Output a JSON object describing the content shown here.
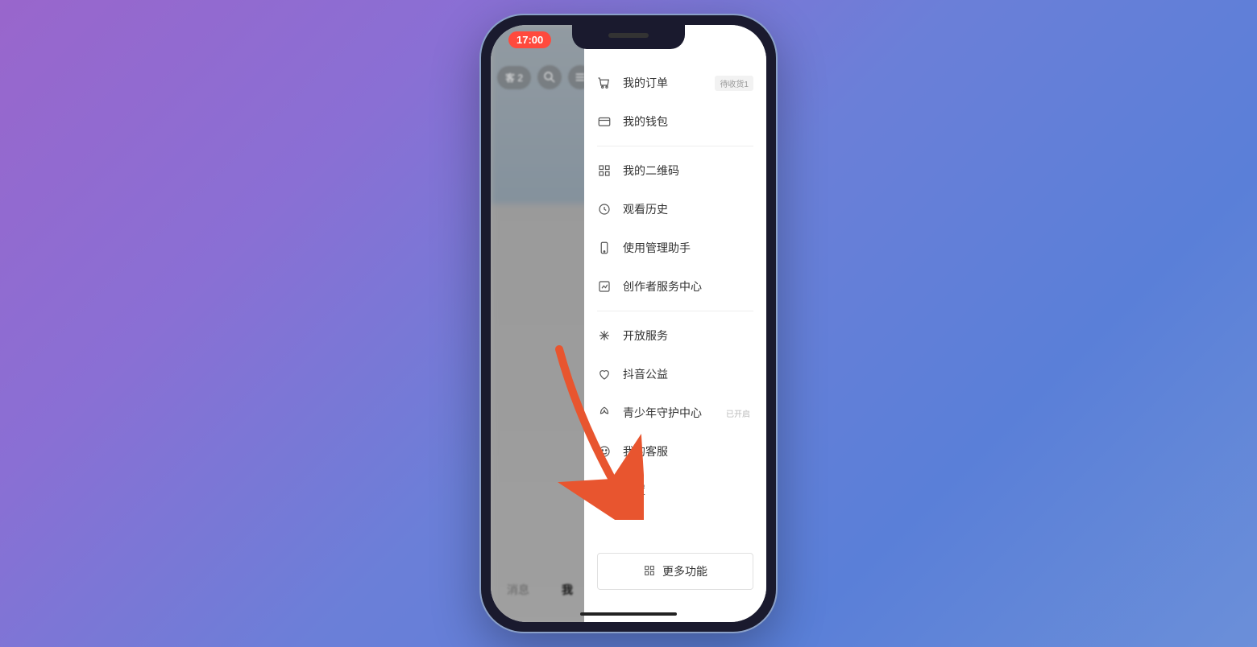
{
  "status": {
    "time": "17:00"
  },
  "background": {
    "top_badge": "客 2",
    "tabs": {
      "messages": "消息",
      "me": "我"
    }
  },
  "drawer": {
    "items": [
      {
        "icon": "cart-icon",
        "label": "我的订单",
        "badge": "待收货1"
      },
      {
        "icon": "wallet-icon",
        "label": "我的钱包"
      }
    ],
    "items2": [
      {
        "icon": "qr-icon",
        "label": "我的二维码"
      },
      {
        "icon": "clock-icon",
        "label": "观看历史"
      },
      {
        "icon": "phone-icon",
        "label": "使用管理助手"
      },
      {
        "icon": "chart-icon",
        "label": "创作者服务中心"
      }
    ],
    "items3": [
      {
        "icon": "spark-icon",
        "label": "开放服务"
      },
      {
        "icon": "heart-icon",
        "label": "抖音公益"
      },
      {
        "icon": "leaf-icon",
        "label": "青少年守护中心",
        "badge_light": "已开启"
      },
      {
        "icon": "support-icon",
        "label": "我的客服"
      },
      {
        "icon": "gear-icon",
        "label": "设置"
      }
    ],
    "more_button": "更多功能"
  }
}
